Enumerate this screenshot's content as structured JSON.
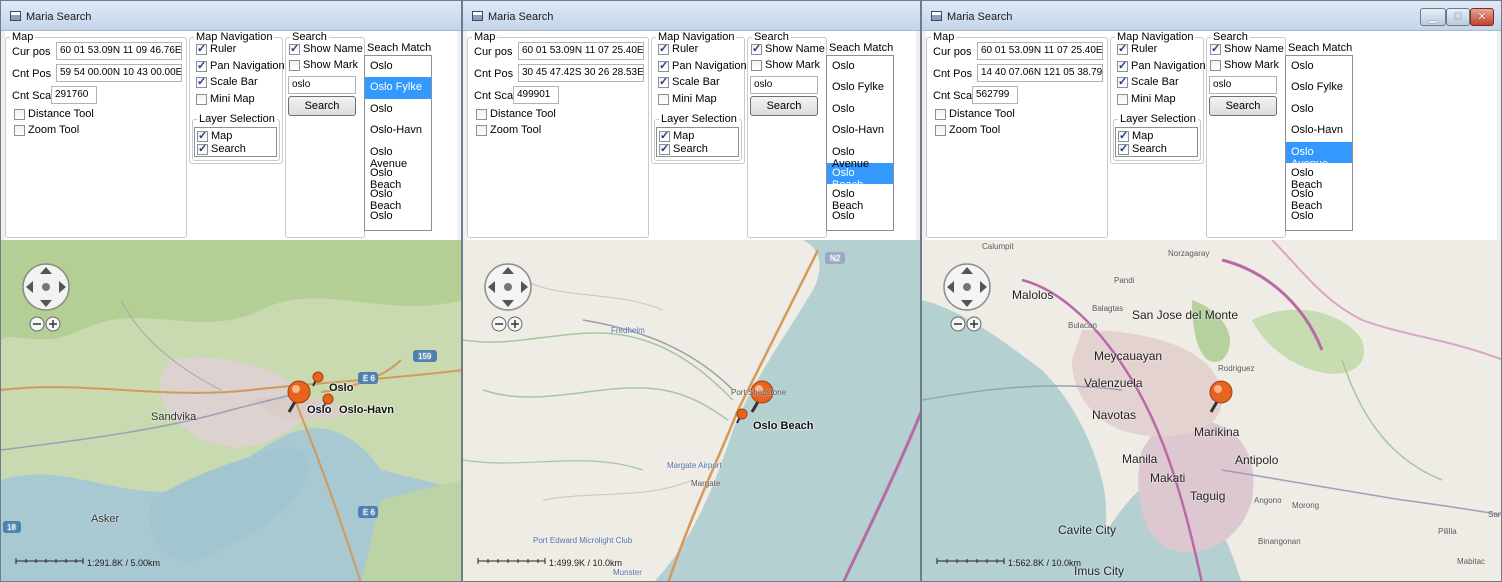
{
  "windows": [
    {
      "title": "Maria Search",
      "map_group": {
        "legend": "Map",
        "cur_pos_label": "Cur pos",
        "cur_pos_value": "60 01 53.09N 11 09 46.76E",
        "cnt_pos_label": "Cnt Pos",
        "cnt_pos_value": "59 54 00.00N 10 43 00.00E",
        "cnt_sca_label": "Cnt Sca",
        "cnt_sca_value": "291760",
        "distance_tool": "Distance Tool",
        "zoom_tool": "Zoom Tool"
      },
      "nav_group": {
        "legend": "Map Navigation",
        "ruler": "Ruler",
        "pan": "Pan Navigation",
        "scale": "Scale Bar",
        "mini": "Mini Map"
      },
      "layer_group": {
        "legend": "Layer Selection",
        "map": "Map",
        "search": "Search"
      },
      "search_group": {
        "legend": "Search",
        "show_name": "Show Name",
        "show_mark": "Show Mark",
        "query": "oslo",
        "button": "Search"
      },
      "match_group": {
        "legend": "Seach Match",
        "items": [
          "Oslo",
          "Oslo Fylke",
          "Oslo",
          "Oslo-Havn",
          "Oslo Avenue",
          "Oslo Beach",
          "Oslo Beach",
          "Oslo"
        ],
        "selected_index": 1
      },
      "map": {
        "scale_text": "1:291.8K / 5.00km",
        "pin_labels": [
          "Oslo",
          "Oslo",
          "Oslo-Havn"
        ],
        "places": [
          "Sandvika",
          "Asker",
          "E 6",
          "E 6",
          "159",
          "18"
        ]
      }
    },
    {
      "title": "Maria Search",
      "map_group": {
        "legend": "Map",
        "cur_pos_label": "Cur pos",
        "cur_pos_value": "60 01 53.09N 11 07 25.40E",
        "cnt_pos_label": "Cnt Pos",
        "cnt_pos_value": "30 45 47.42S 30 26 28.53E",
        "cnt_sca_label": "Cnt Sca",
        "cnt_sca_value": "499901",
        "distance_tool": "Distance Tool",
        "zoom_tool": "Zoom Tool"
      },
      "nav_group": {
        "legend": "Map Navigation",
        "ruler": "Ruler",
        "pan": "Pan Navigation",
        "scale": "Scale Bar",
        "mini": "Mini Map"
      },
      "layer_group": {
        "legend": "Layer Selection",
        "map": "Map",
        "search": "Search"
      },
      "search_group": {
        "legend": "Search",
        "show_name": "Show Name",
        "show_mark": "Show Mark",
        "query": "oslo",
        "button": "Search"
      },
      "match_group": {
        "legend": "Seach Match",
        "items": [
          "Oslo",
          "Oslo Fylke",
          "Oslo",
          "Oslo-Havn",
          "Oslo Avenue",
          "Oslo Beach",
          "Oslo Beach",
          "Oslo"
        ],
        "selected_index": 5
      },
      "map": {
        "scale_text": "1:499.9K / 10.0km",
        "pin_labels": [
          "Oslo Beach"
        ],
        "places": [
          "Port Shepstone",
          "Margate",
          "Margate Airport",
          "Port Edward Microlight Club",
          "N2",
          "Fredheim",
          "Munster"
        ]
      }
    },
    {
      "title": "Maria Search",
      "map_group": {
        "legend": "Map",
        "cur_pos_label": "Cur pos",
        "cur_pos_value": "60 01 53.09N 11 07 25.40E",
        "cnt_pos_label": "Cnt Pos",
        "cnt_pos_value": "14 40 07.06N 121 05 38.79E",
        "cnt_sca_label": "Cnt Sca",
        "cnt_sca_value": "562799",
        "distance_tool": "Distance Tool",
        "zoom_tool": "Zoom Tool"
      },
      "nav_group": {
        "legend": "Map Navigation",
        "ruler": "Ruler",
        "pan": "Pan Navigation",
        "scale": "Scale Bar",
        "mini": "Mini Map"
      },
      "layer_group": {
        "legend": "Layer Selection",
        "map": "Map",
        "search": "Search"
      },
      "search_group": {
        "legend": "Search",
        "show_name": "Show Name",
        "show_mark": "Show Mark",
        "query": "oslo",
        "button": "Search"
      },
      "match_group": {
        "legend": "Seach Match",
        "items": [
          "Oslo",
          "Oslo Fylke",
          "Oslo",
          "Oslo-Havn",
          "Oslo Avenue",
          "Oslo Beach",
          "Oslo Beach",
          "Oslo"
        ],
        "selected_index": 4
      },
      "map": {
        "scale_text": "1:562.8K / 10.0km",
        "pin_labels": [],
        "places": [
          "Malolos",
          "San Jose del Monte",
          "Meycauayan",
          "Valenzuela",
          "Navotas",
          "Marikina",
          "Manila",
          "Makati",
          "Taguig",
          "Antipolo",
          "Cavite City",
          "Imus City",
          "Calumpit",
          "Norzagaray",
          "Pandi",
          "Balagtas",
          "Bulacan",
          "Rodriguez",
          "Angono",
          "Morong",
          "Binangonan",
          "Santa Maria",
          "Pililla",
          "Mabitac"
        ]
      }
    }
  ],
  "colors": {
    "selection": "#3399ff",
    "land": "#eeece4",
    "water": "#b4d0d1",
    "forest": "#b5d29e",
    "urban": "#ddd4d0",
    "road": "#9ba0b8",
    "motorway": "#c86080"
  }
}
